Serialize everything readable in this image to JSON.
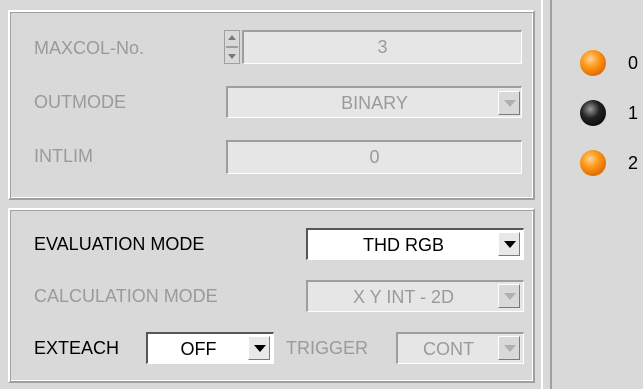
{
  "group1": {
    "maxcol": {
      "label": "MAXCOL-No.",
      "value": "3"
    },
    "outmode": {
      "label": "OUTMODE",
      "value": "BINARY"
    },
    "intlim": {
      "label": "INTLIM",
      "value": "0"
    }
  },
  "group2": {
    "evaluation_mode": {
      "label": "EVALUATION MODE",
      "value": "THD RGB"
    },
    "calculation_mode": {
      "label": "CALCULATION MODE",
      "value": "X Y INT - 2D"
    },
    "exteach": {
      "label": "EXTEACH",
      "value": "OFF"
    },
    "trigger": {
      "label": "TRIGGER",
      "value": "CONT"
    }
  },
  "leds": [
    {
      "label": "0",
      "color": "#ff8c00",
      "state": "on"
    },
    {
      "label": "1",
      "color": "#000000",
      "state": "off"
    },
    {
      "label": "2",
      "color": "#ff8c00",
      "state": "on"
    }
  ]
}
